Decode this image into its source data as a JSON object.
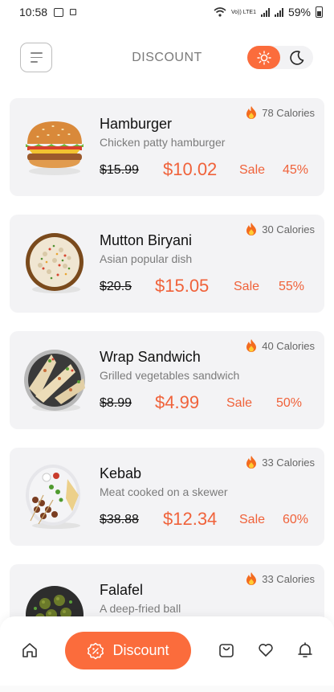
{
  "status_bar": {
    "time": "10:58",
    "battery": "59%",
    "network_label": "Vo)) LTE1"
  },
  "header": {
    "title": "DISCOUNT"
  },
  "items": [
    {
      "name": "Hamburger",
      "description": "Chicken patty hamburger",
      "calories": "78 Calories",
      "old_price": "$15.99",
      "new_price": "$10.02",
      "sale_label": "Sale",
      "percent": "45%"
    },
    {
      "name": "Mutton Biryani",
      "description": "Asian popular dish",
      "calories": "30 Calories",
      "old_price": "$20.5",
      "new_price": "$15.05",
      "sale_label": "Sale",
      "percent": "55%"
    },
    {
      "name": "Wrap Sandwich",
      "description": "Grilled vegetables sandwich",
      "calories": "40 Calories",
      "old_price": "$8.99",
      "new_price": "$4.99",
      "sale_label": "Sale",
      "percent": "50%"
    },
    {
      "name": "Kebab",
      "description": "Meat cooked on a skewer",
      "calories": "33 Calories",
      "old_price": "$38.88",
      "new_price": "$12.34",
      "sale_label": "Sale",
      "percent": "60%"
    },
    {
      "name": "Falafel",
      "description": "A deep-fried ball",
      "calories": "33 Calories"
    }
  ],
  "bottom_nav": {
    "active_label": "Discount",
    "icons": [
      "home-icon",
      "discount-tag-icon",
      "shopping-bag-icon",
      "heart-icon",
      "bell-icon"
    ]
  },
  "colors": {
    "accent": "#fb6c3c",
    "price": "#f0623a",
    "card_bg": "#f3f3f5"
  }
}
